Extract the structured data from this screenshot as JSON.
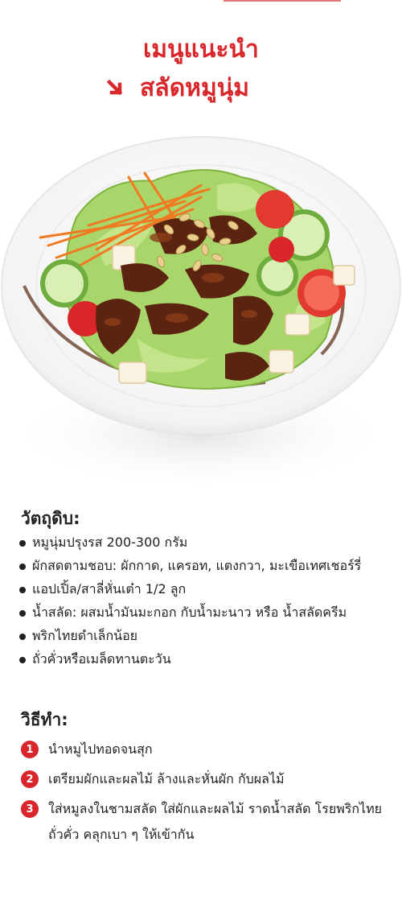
{
  "header": {
    "line1": "เมนูแนะนำ",
    "line2": "สลัดหมูนุ่ม",
    "accent_color": "#d8262b",
    "arrow_icon": "arrow-down-right-icon"
  },
  "photo": {
    "subject": "salad-plate-illustration"
  },
  "ingredients": {
    "title": "วัตถุดิบ:",
    "items": [
      "หมูนุ่มปรุงรส 200-300 กรัม",
      "ผักสดตามชอบ: ผักกาด, แครอท, แตงกวา, มะเขือเทศเชอร์รี่",
      "แอปเปิ้ล/สาลี่หั่นเต๋า 1/2 ลูก",
      "น้ำสลัด: ผสมน้ำมันมะกอก กับน้ำมะนาว หรือ น้ำสลัดครีม",
      "พริกไทยดำเล็กน้อย",
      "ถั่วคั่วหรือเมล็ดทานตะวัน"
    ]
  },
  "method": {
    "title": "วิธีทำ:",
    "steps": [
      {
        "num": "1",
        "text": "นำหมูไปทอดจนสุก"
      },
      {
        "num": "2",
        "text": "เตรียมผักและผลไม้ ล้างและหั่นผัก กับผลไม้"
      },
      {
        "num": "3",
        "text": "ใส่หมูลงในชามสลัด ใส่ผักและผลไม้ ราดน้ำสลัด โรยพริกไทย ถั่วคั่ว คลุกเบา ๆ ให้เข้ากัน"
      }
    ]
  }
}
